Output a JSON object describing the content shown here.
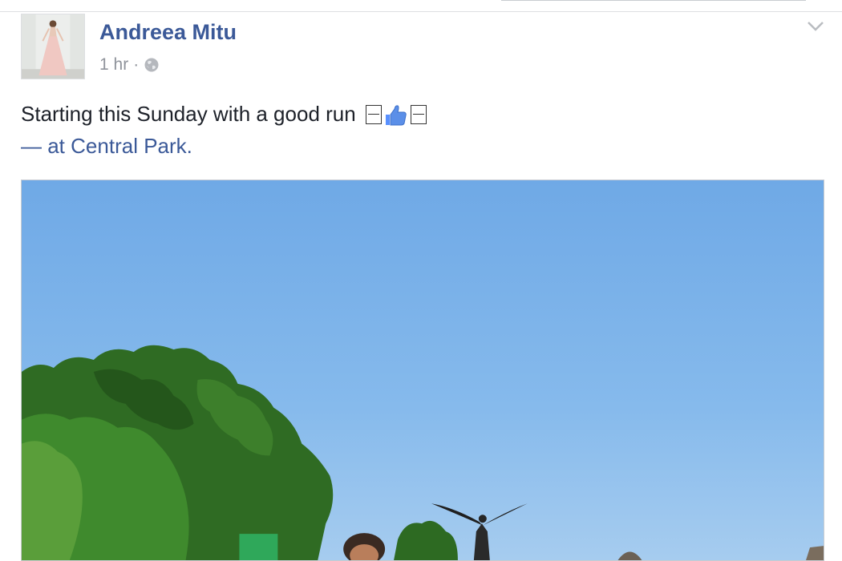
{
  "post": {
    "author": "Andreea Mitu",
    "time": "1 hr",
    "separator": "·",
    "privacy_icon": "globe-icon",
    "menu_icon": "chevron-down-icon",
    "text": "Starting this Sunday with a good run",
    "location_prefix": "— at",
    "location": "Central Park",
    "location_suffix": ".",
    "emoji_icons": [
      "missing-glyph-icon",
      "thumbs-up-icon",
      "missing-glyph-icon"
    ]
  },
  "colors": {
    "link": "#3b5998",
    "text": "#1d2129",
    "meta": "#90949c",
    "sky": "#75b0ea",
    "foliage": "#2f6b23"
  }
}
